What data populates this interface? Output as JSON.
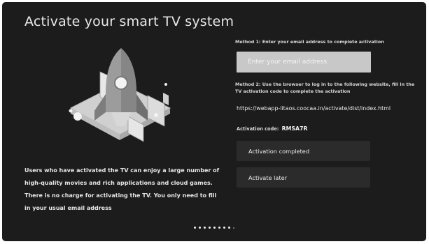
{
  "page": {
    "title": "Activate your smart TV system",
    "description": "Users who have activated the TV can enjoy a large number of high-quality movies and rich applications and cloud games. There is no charge for activating the TV. You only need to fill in your usual email address"
  },
  "method1": {
    "label": "Method 1: Enter your email address to complete activation",
    "email_placeholder": "Enter your email address",
    "email_value": ""
  },
  "method2": {
    "label": "Method 2: Use the browser to log in to the following website, fill in the TV activation code to complete the activation",
    "url": "https://webapp-litaos.coocaa.in/activate/dist/index.html",
    "code_label": "Activation code:",
    "code_value": "RMSA7R"
  },
  "buttons": {
    "completed_label": "Activation completed",
    "later_label": "Activate later"
  },
  "pagination": {
    "total": 8,
    "current": 8
  },
  "colors": {
    "background": "#1c1c1c",
    "email_field": "#c8c8c8",
    "button": "#2b2b2b"
  },
  "icons": {
    "illustration": "rocket-launch-illustration"
  }
}
